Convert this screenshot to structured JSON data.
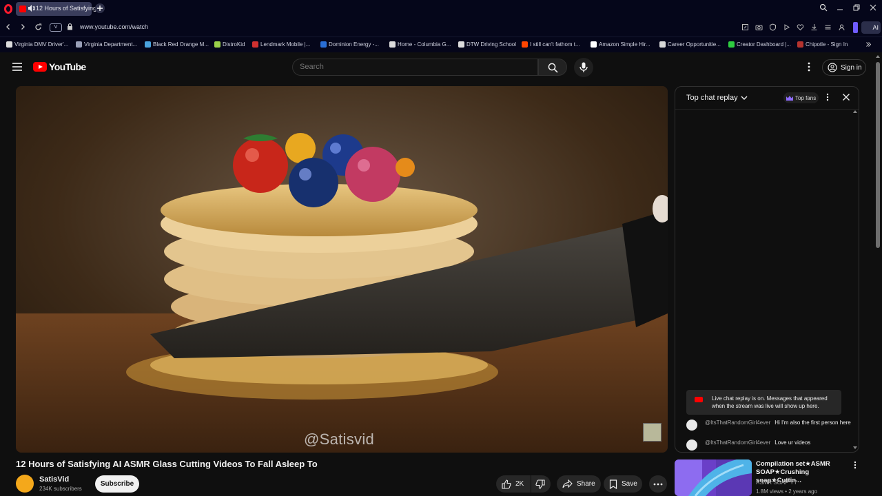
{
  "browser": {
    "tab_title": "12 Hours of Satisfying",
    "url": "www.youtube.com/watch",
    "ai_label": "AI",
    "vpn_label": "V"
  },
  "bookmarks": [
    {
      "label": "Virginia DMV Driver'...",
      "color": "#dcdcdc"
    },
    {
      "label": "Virginia Department...",
      "color": "#9aa0b8"
    },
    {
      "label": "Black Red Orange M...",
      "color": "#4aa3df"
    },
    {
      "label": "DistroKid",
      "color": "#9ad04a"
    },
    {
      "label": "Lendmark Mobile |...",
      "color": "#d03030"
    },
    {
      "label": "Dominion Energy -...",
      "color": "#2a6fd6"
    },
    {
      "label": "Home - Columbia G...",
      "color": "#dcdcdc"
    },
    {
      "label": "DTW Driving School",
      "color": "#dcdcdc"
    },
    {
      "label": "I still can't fathom t...",
      "color": "#ff4500"
    },
    {
      "label": "Amazon Simple Hir...",
      "color": "#ffffff"
    },
    {
      "label": "Career Opportunitie...",
      "color": "#d8d8d8"
    },
    {
      "label": "Creator Dashboard |...",
      "color": "#2ecc40"
    },
    {
      "label": "Chipotle - Sign In",
      "color": "#b5332e"
    }
  ],
  "header": {
    "logo_text": "YouTube",
    "search_placeholder": "Search",
    "signin_label": "Sign in"
  },
  "video": {
    "watermark": "@Satisvid",
    "title": "12 Hours of Satisfying AI ASMR Glass Cutting Videos To Fall Asleep To",
    "channel_name": "SatisVid",
    "subscribers": "234K subscribers",
    "subscribe_label": "Subscribe",
    "likes": "2K",
    "share_label": "Share",
    "save_label": "Save"
  },
  "chat": {
    "title": "Top chat replay",
    "top_fans_label": "Top fans",
    "replay_notice": "Live chat replay is on. Messages that appeared when the stream was live will show up here.",
    "messages": [
      {
        "author": "@ItsThatRandomGirl4ever",
        "text": "Hi I'm also the first person here"
      },
      {
        "author": "@ItsThatRandomGirl4ever",
        "text": "Love ur videos"
      }
    ]
  },
  "recommended": {
    "title": "Compilation set★ASMR SOAP★Crushing soap★Cuttin...",
    "channel": "ASMR SOAP YT",
    "meta": "1.8M views • 2 years ago"
  },
  "colors": {
    "accent_red": "#ff0000",
    "background": "#0f0f0f",
    "browser_chrome": "#05061a",
    "sidebar_accent": "#6f5cff"
  }
}
